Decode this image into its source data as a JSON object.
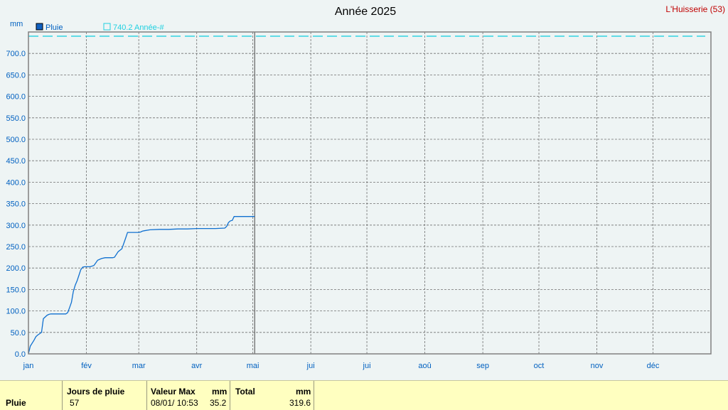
{
  "chart_data": {
    "type": "line",
    "title": "Année 2025",
    "station": "L'Huisserie (53)",
    "ylabel": "mm",
    "ylim": [
      0,
      750
    ],
    "yticks": [
      "0.0",
      "50.0",
      "100.0",
      "150.0",
      "200.0",
      "250.0",
      "300.0",
      "350.0",
      "400.0",
      "450.0",
      "500.0",
      "550.0",
      "600.0",
      "650.0",
      "700.0"
    ],
    "months": [
      "jan",
      "fév",
      "mar",
      "avr",
      "mai",
      "jui",
      "jui",
      "aoû",
      "sep",
      "oct",
      "nov",
      "déc"
    ],
    "grid": true,
    "legend": [
      {
        "label": "Pluie",
        "color": "#1060c0"
      },
      {
        "label": "740.2 Année-#",
        "color": "#20d0e0"
      }
    ],
    "current_date_day": 121,
    "series": [
      {
        "name": "Pluie",
        "color": "#1070d0",
        "x": [
          0,
          1,
          3,
          4,
          5,
          6,
          7,
          8,
          10,
          11,
          12,
          13,
          14,
          15,
          18,
          20,
          21,
          22,
          23,
          24,
          25,
          26,
          27,
          28,
          29,
          30,
          31,
          33,
          35,
          36,
          37,
          39,
          41,
          43,
          45,
          46,
          48,
          50,
          52,
          53,
          54,
          56,
          58,
          59,
          60,
          61,
          62,
          65,
          70,
          75,
          80,
          85,
          90,
          95,
          100,
          105,
          106,
          107,
          108,
          109,
          110,
          112,
          115,
          118,
          121
        ],
        "y": [
          0,
          18,
          32,
          40,
          44,
          47,
          50,
          82,
          90,
          92,
          93,
          93,
          93,
          93,
          93,
          93,
          96,
          108,
          120,
          145,
          160,
          170,
          183,
          196,
          202,
          203,
          203,
          203,
          206,
          212,
          218,
          222,
          224,
          224,
          224,
          225,
          238,
          245,
          270,
          283,
          283,
          283,
          283,
          283,
          284,
          286,
          287,
          289,
          290,
          290,
          291,
          291,
          292,
          292,
          292,
          293,
          297,
          306,
          310,
          311,
          320,
          320,
          320,
          320,
          320
        ]
      }
    ],
    "reference_lines": [
      {
        "name": "740.2 Année-#",
        "value": 740.2,
        "color": "#20d0e0",
        "style": "dashed"
      }
    ]
  },
  "stats": {
    "row_label": "Pluie",
    "rain_days_header": "Jours de pluie",
    "rain_days_value": "57",
    "max_header": "Valeur Max",
    "max_unit": "mm",
    "max_date": "08/01/  10:53",
    "max_value": "35.2",
    "total_header": "Total",
    "total_unit": "mm",
    "total_value": "319.6"
  }
}
